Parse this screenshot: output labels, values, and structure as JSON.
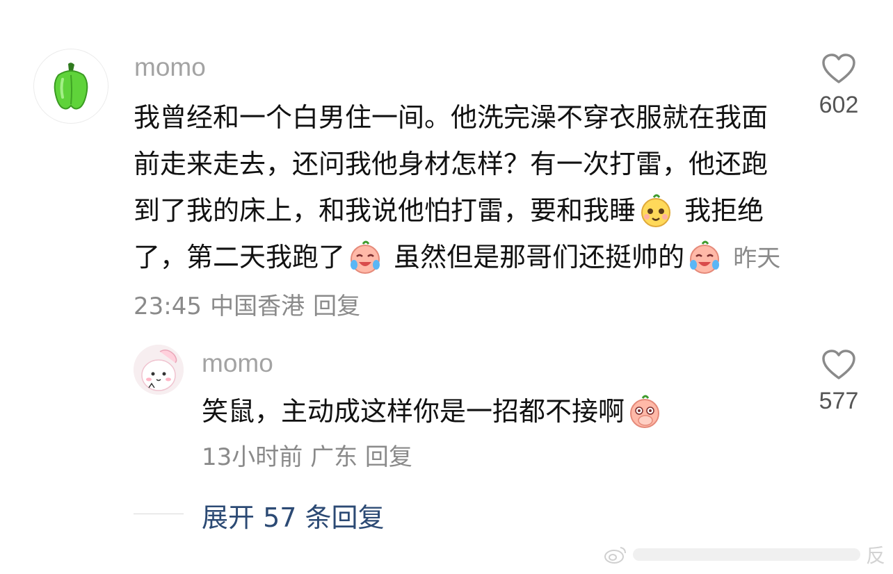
{
  "comment": {
    "username": "momo",
    "text_parts": [
      "我曾经和一个白男住一间。他洗完澡不穿衣服就在我面前走来走去，还问我他身材怎样？有一次打雷，他还跑到了我的床上，和我说他怕打雷，要和我睡",
      "我拒绝了，第二天我跑了",
      "虽然但是那哥们还挺帅的"
    ],
    "time": "昨天 23:45",
    "location": "中国香港",
    "reply_label": "回复",
    "like_count": "602",
    "avatar_icon": "green-pepper-icon"
  },
  "reply": {
    "username": "momo",
    "text": "笑鼠，主动成这样你是一招都不接啊",
    "time": "13小时前",
    "location": "广东",
    "reply_label": "回复",
    "like_count": "577",
    "avatar_icon": "pink-bunny-icon"
  },
  "expand": {
    "label": "展开 57 条回复"
  },
  "watermark": {
    "logo_icon": "weibo-icon",
    "end_text": "反"
  },
  "colors": {
    "username": "#a3a3a3",
    "meta": "#8a8a8a",
    "expand": "#2c4a74",
    "pepper": "#5fd33a"
  }
}
